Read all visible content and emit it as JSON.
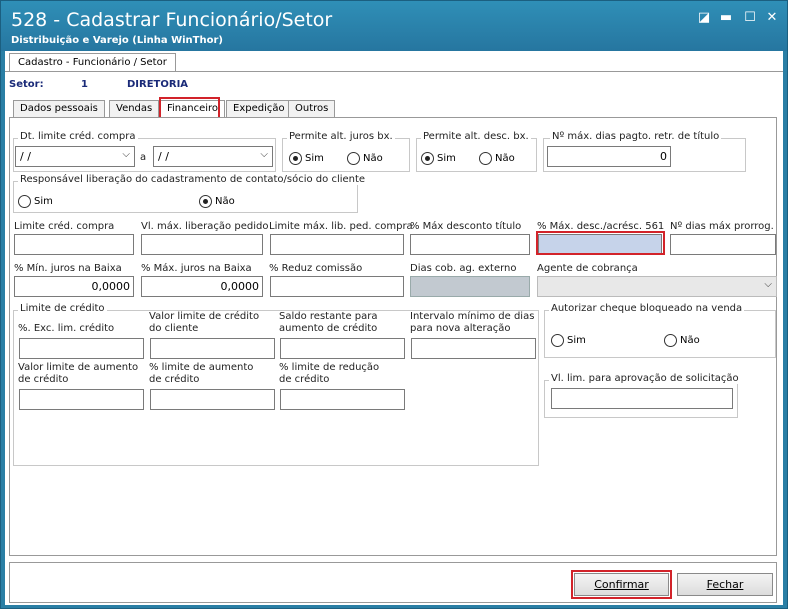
{
  "window": {
    "title": "528 - Cadastrar Funcionário/Setor",
    "subtitle": "Distribuição e Varejo (Linha WinThor)",
    "btn_restore": "◪",
    "btn_min": "▬",
    "btn_max": "☐",
    "btn_close": "✕"
  },
  "outer_tab": "Cadastro - Funcionário / Setor",
  "setor": {
    "label": "Setor:",
    "code": "1",
    "name": "DIRETORIA"
  },
  "tabs": [
    "Dados pessoais",
    "Vendas",
    "Financeiro",
    "Expedição",
    "Outros"
  ],
  "active_tab": "Financeiro",
  "fin": {
    "dt_limite": {
      "label": "Dt. limite créd. compra",
      "from": " / /",
      "sep": "a",
      "to": " / /"
    },
    "juros": {
      "label": "Permite alt. juros bx.",
      "sim": "Sim",
      "nao": "Não",
      "selected": "Sim"
    },
    "desc": {
      "label": "Permite alt. desc. bx.",
      "sim": "Sim",
      "nao": "Não",
      "selected": "Sim"
    },
    "dias_pagto": {
      "label": "Nº máx. dias pagto. retr. de título",
      "value": "0"
    },
    "resp": {
      "label": "Responsável liberação do cadastramento de contato/sócio do cliente",
      "sim": "Sim",
      "nao": "Não",
      "selected": "Não"
    },
    "row1": {
      "limite_cred": "Limite créd. compra",
      "vl_max_lib": "Vl. máx. liberação pedido",
      "limite_max_lib": "Limite máx. lib. ped. compra",
      "pct_max_desc": "% Máx desconto título",
      "pct_max_desc_561": "% Máx. desc./acrésc. 561",
      "dias_prorrog": "Nº dias máx prorrog."
    },
    "row2": {
      "min_juros": "% Mín. juros na Baixa",
      "min_juros_val": "0,0000",
      "max_juros": "% Máx. juros na Baixa",
      "max_juros_val": "0,0000",
      "reduz": "% Reduz  comissão",
      "dias_cob": "Dias cob. ag. externo",
      "agente": "Agente de cobrança"
    },
    "limite_credito": {
      "group": "Limite de crédito",
      "exc": "%. Exc. lim. crédito",
      "valor_lim": "Valor limite de crédito do cliente",
      "saldo": "Saldo restante para aumento de crédito",
      "intervalo": "Intervalo mínimo de dias para nova alteração",
      "valor_aum": "Valor limite de aumento de crédito",
      "pct_aum": "% limite de aumento de crédito",
      "pct_red": "% limite de redução de crédito"
    },
    "cheque": {
      "label": "Autorizar cheque bloqueado na venda",
      "sim": "Sim",
      "nao": "Não"
    },
    "vl_lim_aprov": "Vl. lim. para aprovação de solicitação"
  },
  "footer": {
    "confirmar": "Confirmar",
    "fechar": "Fechar"
  },
  "colors": {
    "titlebar": "#2a7fa5",
    "highlight": "#d2232a",
    "field_blue": "#c6d3ea"
  }
}
